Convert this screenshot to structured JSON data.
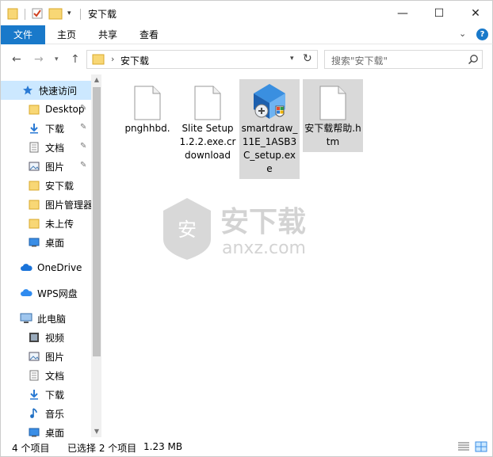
{
  "titlebar": {
    "title": "安下载",
    "minimize_glyph": "—",
    "maximize_glyph": "☐",
    "close_glyph": "✕",
    "dropdown_glyph": "▾"
  },
  "ribbon": {
    "tabs": [
      {
        "label": "文件"
      },
      {
        "label": "主页"
      },
      {
        "label": "共享"
      },
      {
        "label": "查看"
      }
    ],
    "expand_glyph": "⌄",
    "help_glyph": "?"
  },
  "address": {
    "back_glyph": "←",
    "forward_glyph": "→",
    "recent_glyph": "▾",
    "up_glyph": "↑",
    "path_sep": "›",
    "path": "安下载",
    "dropdown_glyph": "▾",
    "refresh_glyph": "↻",
    "search_placeholder": "搜索\"安下载\""
  },
  "navpane": {
    "items": [
      {
        "label": "快速访问",
        "icon": "star-icon"
      },
      {
        "label": "Desktop",
        "icon": "folder-icon",
        "pinned": true
      },
      {
        "label": "下载",
        "icon": "download-icon",
        "pinned": true
      },
      {
        "label": "文档",
        "icon": "document-icon",
        "pinned": true
      },
      {
        "label": "图片",
        "icon": "picture-icon",
        "pinned": true
      },
      {
        "label": "安下载",
        "icon": "folder-icon"
      },
      {
        "label": "图片管理器",
        "icon": "folder-icon"
      },
      {
        "label": "未上传",
        "icon": "folder-icon"
      },
      {
        "label": "桌面",
        "icon": "desktop-icon"
      },
      {
        "label": "OneDrive",
        "icon": "cloud-icon"
      },
      {
        "label": "WPS网盘",
        "icon": "cloud-icon"
      },
      {
        "label": "此电脑",
        "icon": "computer-icon"
      },
      {
        "label": "视频",
        "icon": "video-icon"
      },
      {
        "label": "图片",
        "icon": "picture-icon"
      },
      {
        "label": "文档",
        "icon": "document-icon"
      },
      {
        "label": "下载",
        "icon": "download-icon"
      },
      {
        "label": "音乐",
        "icon": "music-icon"
      },
      {
        "label": "桌面",
        "icon": "desktop-icon"
      }
    ],
    "pin_glyph": "📌",
    "scroll_up_glyph": "▲",
    "scroll_down_glyph": "▼"
  },
  "files": [
    {
      "name": "pnghhbd.",
      "icon": "blank-file-icon",
      "selected": false
    },
    {
      "name": "Slite Setup 1.2.2.exe.crdownload",
      "icon": "blank-file-icon",
      "selected": false
    },
    {
      "name": "smartdraw_11E_1ASB3C_setup.exe",
      "icon": "installer-icon",
      "selected": true
    },
    {
      "name": "安下载帮助.htm",
      "icon": "blank-file-icon",
      "selected": true
    }
  ],
  "watermark": {
    "text": "安下载",
    "subtext": "anxz.com",
    "badge": "安"
  },
  "statusbar": {
    "item_count": "4 个项目",
    "selected": "已选择 2 个项目",
    "size": "1.23 MB"
  },
  "colors": {
    "accent": "#1979ca",
    "selection": "#cce8ff",
    "file_selection": "#d9d9d9",
    "folder": "#f8d775"
  }
}
